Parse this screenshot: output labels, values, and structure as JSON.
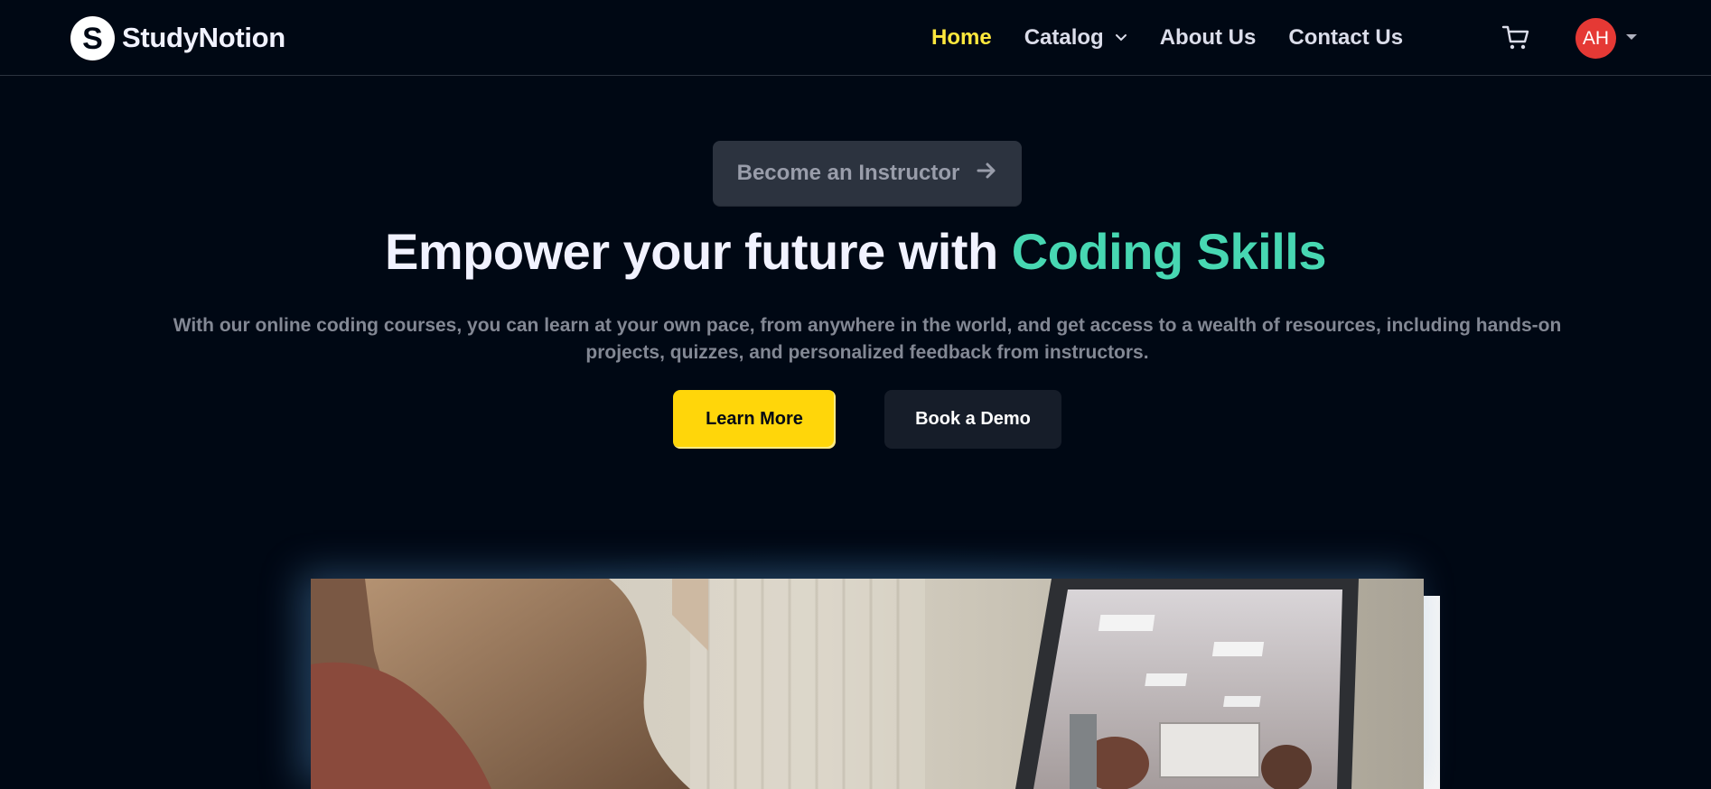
{
  "brand": {
    "name": "StudyNotion",
    "logo_letter": "S"
  },
  "nav": {
    "links": [
      {
        "label": "Home",
        "active": true
      },
      {
        "label": "Catalog",
        "dropdown": true
      },
      {
        "label": "About Us"
      },
      {
        "label": "Contact Us"
      }
    ],
    "cart_icon": "cart-icon",
    "user_initials": "AH"
  },
  "hero": {
    "instructor_button": "Become an Instructor",
    "title_prefix": "Empower your future with",
    "title_highlight": "Coding Skills",
    "subtitle": "With our online coding courses, you can learn at your own pace, from anywhere in the world, and get access to a wealth of resources, including hands-on projects, quizzes, and personalized feedback from instructors.",
    "learn_more": "Learn More",
    "book_demo": "Book a Demo"
  },
  "colors": {
    "background": "#000814",
    "accent_yellow": "#FFE83D",
    "button_yellow": "#FFD60A",
    "highlight_teal": "#47D7B2",
    "avatar_red": "#E53935"
  }
}
